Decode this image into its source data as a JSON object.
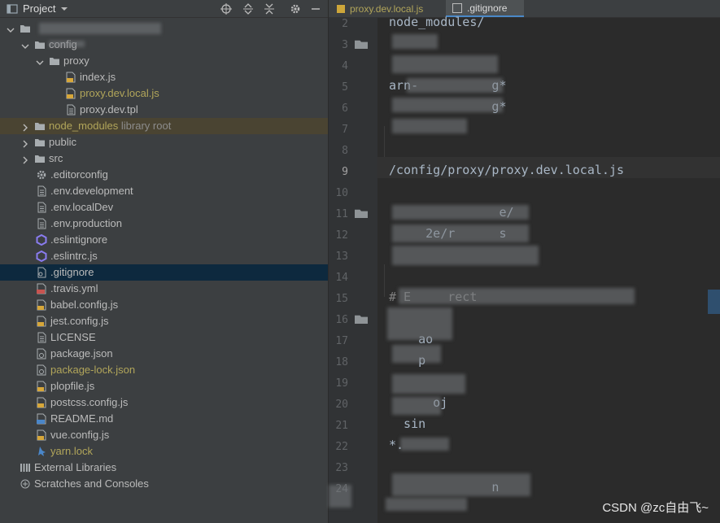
{
  "project_panel": {
    "title": "Project",
    "toolbar_icons": [
      "crosshair-icon",
      "expand-all-icon",
      "collapse-all-icon",
      "gear-icon",
      "minimize-icon"
    ],
    "tree": [
      {
        "label": "",
        "kind": "folder",
        "expanded": true,
        "blurred": true
      },
      {
        "label": "config",
        "kind": "folder",
        "expanded": true
      },
      {
        "label": "proxy",
        "kind": "folder",
        "expanded": true
      },
      {
        "label": "index.js",
        "kind": "js"
      },
      {
        "label": "proxy.dev.local.js",
        "kind": "js",
        "color": "#b1a55a"
      },
      {
        "label": "proxy.dev.tpl",
        "kind": "text"
      },
      {
        "label": "node_modules",
        "kind": "folder",
        "expanded": false,
        "color": "#b1a55a",
        "extra": "library root",
        "highlighted": true
      },
      {
        "label": "public",
        "kind": "folder",
        "expanded": false
      },
      {
        "label": "src",
        "kind": "folder",
        "expanded": false
      },
      {
        "label": ".editorconfig",
        "kind": "gear"
      },
      {
        "label": ".env.development",
        "kind": "text"
      },
      {
        "label": ".env.localDev",
        "kind": "text"
      },
      {
        "label": ".env.production",
        "kind": "text"
      },
      {
        "label": ".eslintignore",
        "kind": "eslint"
      },
      {
        "label": ".eslintrc.js",
        "kind": "eslint"
      },
      {
        "label": ".gitignore",
        "kind": "gitignore",
        "selected": true
      },
      {
        "label": ".travis.yml",
        "kind": "yml"
      },
      {
        "label": "babel.config.js",
        "kind": "js"
      },
      {
        "label": "jest.config.js",
        "kind": "js"
      },
      {
        "label": "LICENSE",
        "kind": "text"
      },
      {
        "label": "package.json",
        "kind": "json"
      },
      {
        "label": "package-lock.json",
        "kind": "json",
        "color": "#b1a55a"
      },
      {
        "label": "plopfile.js",
        "kind": "js"
      },
      {
        "label": "postcss.config.js",
        "kind": "js"
      },
      {
        "label": "README.md",
        "kind": "md"
      },
      {
        "label": "vue.config.js",
        "kind": "js"
      },
      {
        "label": "yarn.lock",
        "kind": "yarn",
        "color": "#b1a55a"
      },
      {
        "label": "External Libraries",
        "kind": "libraries"
      },
      {
        "label": "Scratches and Consoles",
        "kind": "scratches"
      }
    ]
  },
  "editor": {
    "tabs": [
      {
        "label": "proxy.dev.local.js",
        "active": false,
        "color": "#b1a55a"
      },
      {
        "label": ".gitignore",
        "active": true,
        "color": "#dcdcdc"
      }
    ],
    "current_line": 9,
    "lines": [
      {
        "n": "2",
        "text": "node_modules/"
      },
      {
        "n": "3",
        "text": ""
      },
      {
        "n": "4",
        "text": ""
      },
      {
        "n": "5",
        "text": "arn-          g*"
      },
      {
        "n": "6",
        "text": "              g*"
      },
      {
        "n": "7",
        "text": ""
      },
      {
        "n": "8",
        "text": ""
      },
      {
        "n": "9",
        "text": "/config/proxy/proxy.dev.local.js"
      },
      {
        "n": "10",
        "text": ""
      },
      {
        "n": "11",
        "text": "               e/"
      },
      {
        "n": "12",
        "text": "     2e/r      s"
      },
      {
        "n": "13",
        "text": ""
      },
      {
        "n": "14",
        "text": ""
      },
      {
        "n": "15",
        "text": "# E     rect"
      },
      {
        "n": "16",
        "text": ""
      },
      {
        "n": "17",
        "text": "    ao"
      },
      {
        "n": "18",
        "text": "    p"
      },
      {
        "n": "19",
        "text": ""
      },
      {
        "n": "20",
        "text": "      oj"
      },
      {
        "n": "21",
        "text": "  sin"
      },
      {
        "n": "22",
        "text": "*."
      },
      {
        "n": "23",
        "text": ""
      },
      {
        "n": "24",
        "text": "              n"
      }
    ]
  },
  "watermark": "CSDN @zc自由飞~"
}
